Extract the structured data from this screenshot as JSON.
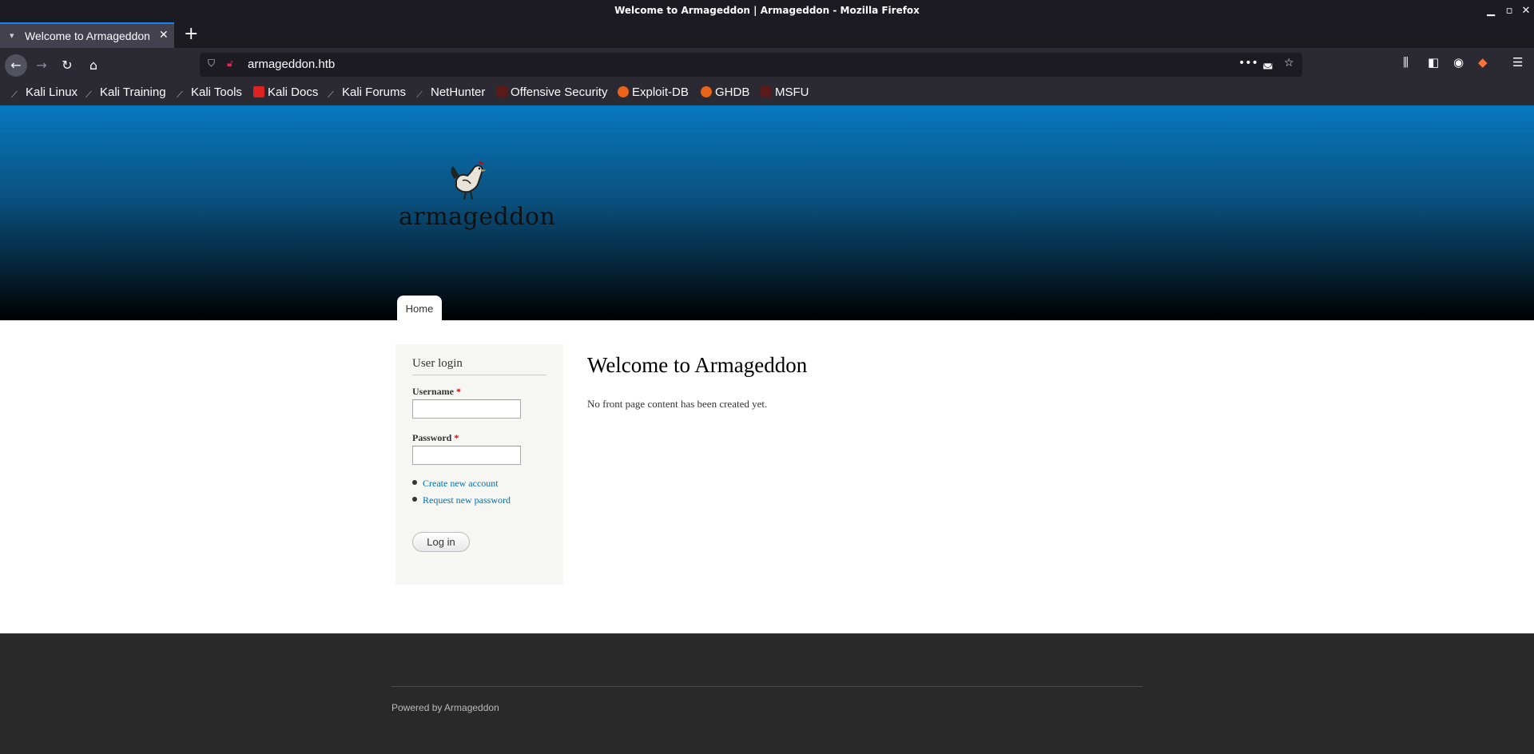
{
  "window": {
    "title": "Welcome to Armageddon | Armageddon - Mozilla Firefox"
  },
  "tabs": [
    {
      "label": "Welcome to Armageddon | Armageddon",
      "close": "✕"
    }
  ],
  "newtab_label": "+",
  "navbar": {
    "url": "armageddon.htb"
  },
  "bookmarks": [
    {
      "label": "Kali Linux",
      "icon": "kali-dragon-icon"
    },
    {
      "label": "Kali Training",
      "icon": "kali-dragon-icon"
    },
    {
      "label": "Kali Tools",
      "icon": "kali-dragon-icon"
    },
    {
      "label": "Kali Docs",
      "icon": "kali-docs-icon"
    },
    {
      "label": "Kali Forums",
      "icon": "kali-dragon-icon"
    },
    {
      "label": "NetHunter",
      "icon": "nethunter-icon"
    },
    {
      "label": "Offensive Security",
      "icon": "offsec-icon"
    },
    {
      "label": "Exploit-DB",
      "icon": "exploitdb-icon"
    },
    {
      "label": "GHDB",
      "icon": "exploitdb-icon"
    },
    {
      "label": "MSFU",
      "icon": "offsec-icon"
    }
  ],
  "site": {
    "logo_text": "armageddon",
    "nav_home": "Home",
    "login": {
      "title": "User login",
      "username_label": "Username",
      "password_label": "Password",
      "required_mark": "*",
      "links": [
        "Create new account",
        "Request new password"
      ],
      "submit": "Log in"
    },
    "main": {
      "title": "Welcome to Armageddon",
      "text": "No front page content has been created yet."
    },
    "footer": "Powered by Armageddon"
  },
  "colors": {
    "accent": "#0a84ff",
    "link": "#0071b3",
    "header_top": "#0779bf",
    "footer_bg": "#292929"
  }
}
